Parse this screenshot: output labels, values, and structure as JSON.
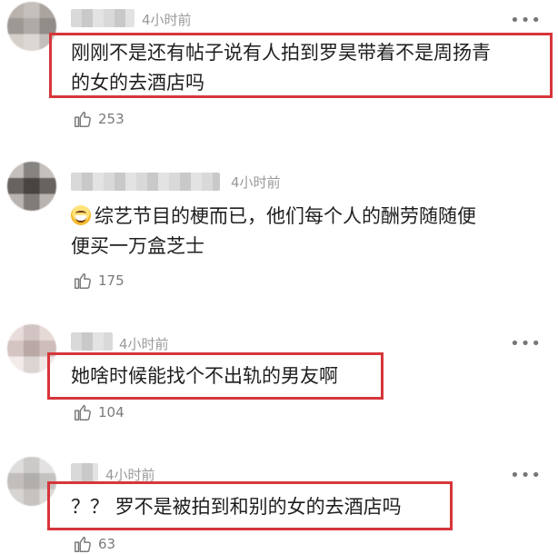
{
  "comments": [
    {
      "time": "4小时前",
      "lines": [
        "刚刚不是还有帖子说有人拍到罗昊带着不是周扬青",
        "的女的去酒店吗"
      ],
      "likes": "253",
      "highlighted": true
    },
    {
      "time": "4小时前",
      "lines": [
        "综艺节目的梗而已，他们每个人的酬劳随随便",
        "便买一万盒芝士"
      ],
      "likes": "175",
      "highlighted": false,
      "emoji": "grinning-face-emoji"
    },
    {
      "time": "4小时前",
      "lines": [
        "她啥时候能找个不出轨的男友啊"
      ],
      "likes": "104",
      "highlighted": true
    },
    {
      "time": "4小时前",
      "lines": [
        "？？ 罗不是被拍到和别的女的去酒店吗"
      ],
      "likes": "63",
      "highlighted": true
    }
  ],
  "icons": {
    "like": "thumbs-up-icon",
    "more": "more-dots-icon"
  },
  "colors": {
    "highlight_border": "#d6363b",
    "meta_text": "#9a9a9a"
  }
}
